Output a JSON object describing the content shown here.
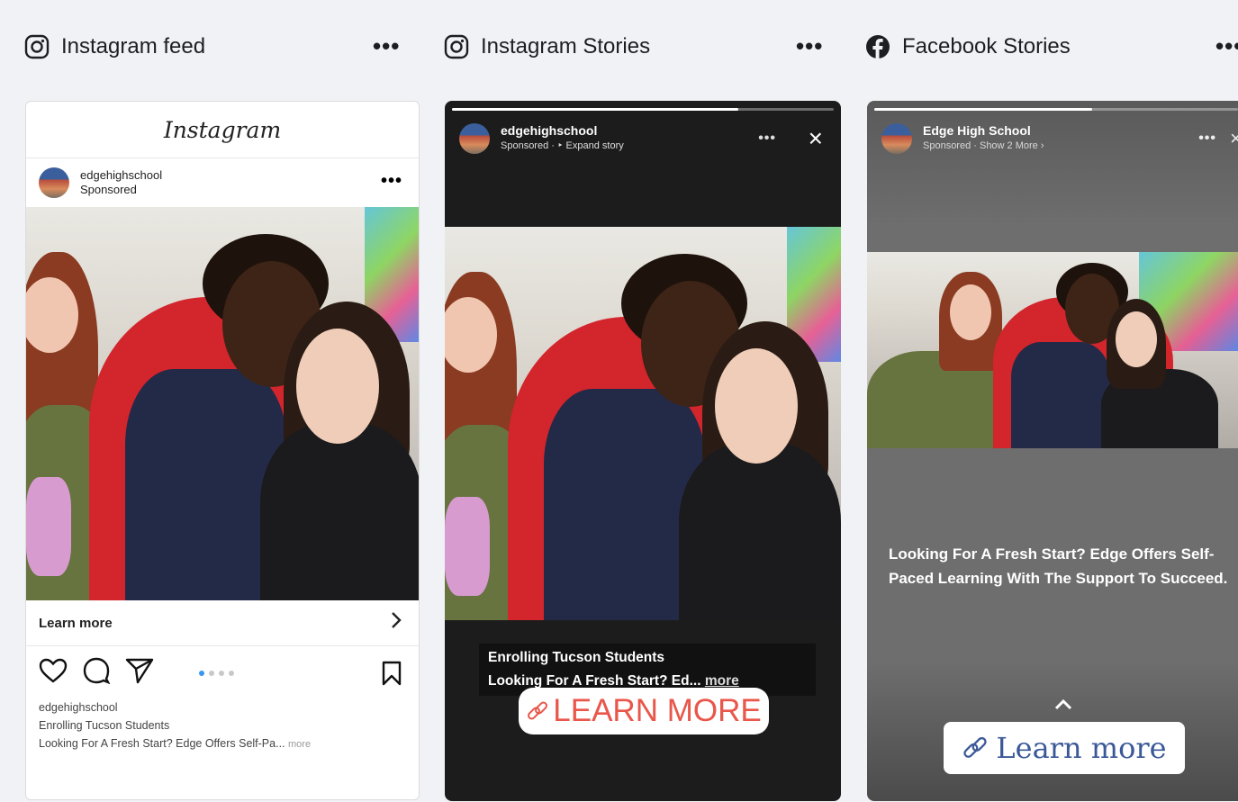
{
  "columns": [
    {
      "title": "Instagram feed",
      "icon": "instagram-icon",
      "menu": "•••"
    },
    {
      "title": "Instagram Stories",
      "icon": "instagram-icon",
      "menu": "•••"
    },
    {
      "title": "Facebook Stories",
      "icon": "facebook-icon",
      "menu": "•••"
    }
  ],
  "feed": {
    "brand": "Instagram",
    "account": "edgehighschool",
    "sponsored": "Sponsored",
    "menu": "•••",
    "learn_more": "Learn more",
    "chevron": "›",
    "caption_account": "edgehighschool",
    "caption_line1": "Enrolling Tucson Students",
    "caption_line2": "Looking For A Fresh Start? Edge Offers Self-Pa...",
    "caption_more": "more",
    "carousel_index": 1,
    "carousel_count": 4
  },
  "ig_story": {
    "account": "edgehighschool",
    "sub": "Sponsored · ‣ Expand story",
    "menu": "•••",
    "close": "×",
    "progress": 0.75,
    "caption_line1": "Enrolling Tucson Students",
    "caption_line2": "Looking For A Fresh Start? Ed...",
    "caption_more": "more",
    "cta": "LEARN MORE",
    "cta_color": "#e9564a"
  },
  "fb_story": {
    "account": "Edge High School",
    "sub": "Sponsored · Show 2 More ›",
    "menu": "•••",
    "close": "×",
    "progress": 0.6,
    "headline": "Looking For A Fresh Start? Edge Offers Self-Paced Learning With The Support To Succeed.",
    "swipe_up": "^",
    "cta": "Learn more",
    "cta_color": "#3b5998"
  }
}
